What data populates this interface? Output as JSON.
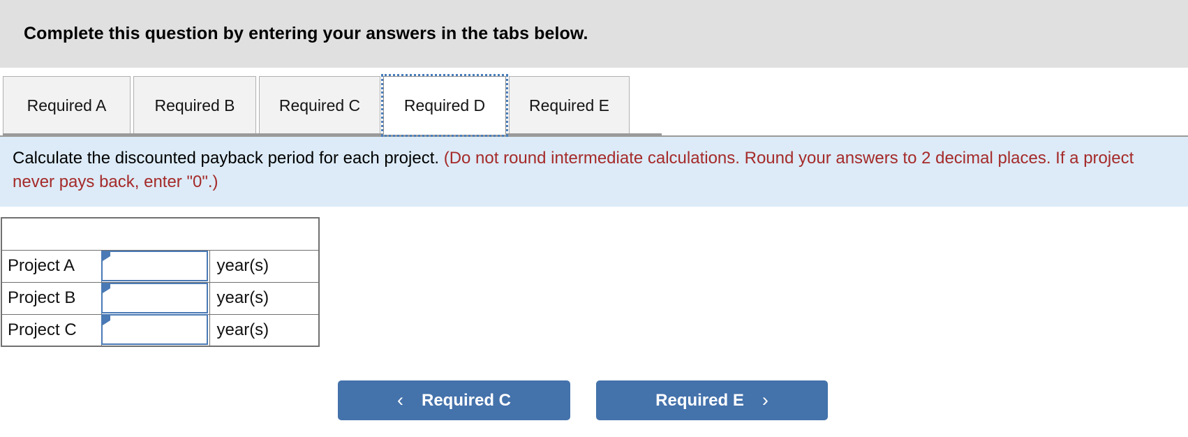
{
  "header": {
    "title": "Complete this question by entering your answers in the tabs below."
  },
  "tabs": {
    "items": [
      {
        "label": "Required A",
        "active": false
      },
      {
        "label": "Required B",
        "active": false
      },
      {
        "label": "Required C",
        "active": false
      },
      {
        "label": "Required D",
        "active": true
      },
      {
        "label": "Required E",
        "active": false
      }
    ]
  },
  "instruction": {
    "main": "Calculate the discounted payback period for each project. ",
    "note": "(Do not round intermediate calculations. Round your answers to 2 decimal places. If a project never pays back, enter \"0\".)",
    "note_color": "#a52a2a",
    "background_color": "#dcebf7"
  },
  "answer_table": {
    "header_cell": "",
    "rows": [
      {
        "label": "Project A",
        "value": "",
        "unit": "year(s)"
      },
      {
        "label": "Project B",
        "value": "",
        "unit": "year(s)"
      },
      {
        "label": "Project C",
        "value": "",
        "unit": "year(s)"
      }
    ]
  },
  "navigation": {
    "prev_label": "Required C",
    "next_label": "Required E",
    "prev_icon": "chevron-left-icon",
    "next_icon": "chevron-right-icon",
    "prev_chevron": "‹",
    "next_chevron": "›",
    "button_color": "#4472ab"
  }
}
